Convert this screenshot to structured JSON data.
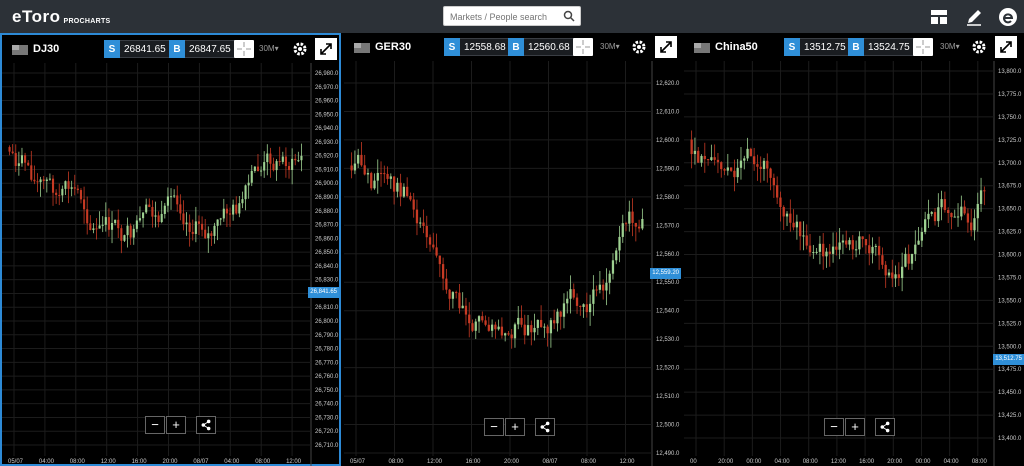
{
  "app": {
    "logo_main": "eToro",
    "logo_sub": "PROCHARTS",
    "search_placeholder": "Markets / People search",
    "icons": [
      "layout-icon",
      "pencil-icon",
      "etoro-e-icon"
    ]
  },
  "colors": {
    "up": "#9ed191",
    "down": "#c73a24",
    "accent": "#2f8fd8",
    "grid": "#1c1c1c"
  },
  "panels": [
    {
      "symbol": "DJ30",
      "sell_label": "S",
      "sell": "26841.65",
      "buy_label": "B",
      "buy": "26847.65",
      "timeframe": "30M",
      "active": true,
      "current_price": "26,841.65",
      "yticks": [
        "26,980.0",
        "26,970.0",
        "26,960.0",
        "26,950.0",
        "26,940.0",
        "26,930.0",
        "26,920.0",
        "26,910.0",
        "26,900.0",
        "26,890.0",
        "26,880.0",
        "26,870.0",
        "26,860.0",
        "26,850.0",
        "26,840.0",
        "26,830.0",
        "26,820.0",
        "26,810.0",
        "26,800.0",
        "26,790.0",
        "26,780.0",
        "26,770.0",
        "26,760.0",
        "26,750.0",
        "26,740.0",
        "26,730.0",
        "26,720.0",
        "26,710.0"
      ],
      "xticks": [
        "05/07",
        "04:00",
        "08:00",
        "12:00",
        "16:00",
        "20:00",
        "08/07",
        "04:00",
        "08:00",
        "12:00"
      ],
      "zoom_out": "−",
      "zoom_in": "+"
    },
    {
      "symbol": "GER30",
      "sell_label": "S",
      "sell": "12558.68",
      "buy_label": "B",
      "buy": "12560.68",
      "timeframe": "30M",
      "active": false,
      "current_price": "12,559.20",
      "yticks": [
        "12,620.0",
        "12,610.0",
        "12,600.0",
        "12,590.0",
        "12,580.0",
        "12,570.0",
        "12,560.0",
        "12,550.0",
        "12,540.0",
        "12,530.0",
        "12,520.0",
        "12,510.0",
        "12,500.0",
        "12,490.0"
      ],
      "xticks": [
        "05/07",
        "08:00",
        "12:00",
        "16:00",
        "20:00",
        "08/07",
        "08:00",
        "12:00"
      ],
      "zoom_out": "−",
      "zoom_in": "+"
    },
    {
      "symbol": "China50",
      "sell_label": "S",
      "sell": "13512.75",
      "buy_label": "B",
      "buy": "13524.75",
      "timeframe": "30M",
      "active": false,
      "current_price": "13,512.75",
      "yticks": [
        "13,800.0",
        "13,775.0",
        "13,750.0",
        "13,725.0",
        "13,700.0",
        "13,675.0",
        "13,650.0",
        "13,625.0",
        "13,600.0",
        "13,575.0",
        "13,550.0",
        "13,525.0",
        "13,500.0",
        "13,475.0",
        "13,450.0",
        "13,425.0",
        "13,400.0"
      ],
      "xticks": [
        "00",
        "20:00",
        "00:00",
        "04:00",
        "08:00",
        "12:00",
        "16:00",
        "20:00",
        "00:00",
        "04:00",
        "08:00"
      ],
      "zoom_out": "−",
      "zoom_in": "+"
    }
  ]
}
